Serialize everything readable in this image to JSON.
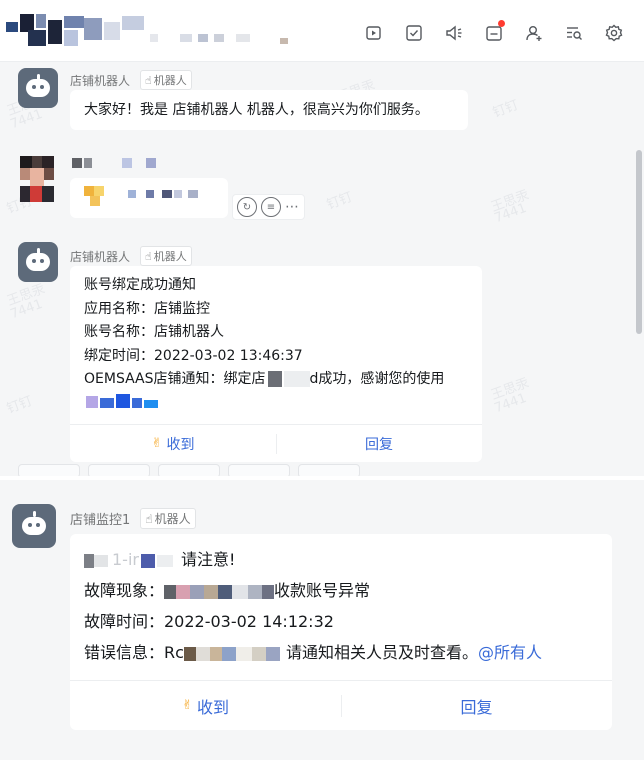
{
  "header": {
    "icons": [
      "video-icon",
      "todo-icon",
      "announcement-icon",
      "calendar-icon",
      "add-member-icon",
      "search-history-icon",
      "settings-icon"
    ],
    "accent": "#3a6bd8",
    "notify_color": "#ff3b30"
  },
  "watermark": {
    "name": "王思汞",
    "id": "7441",
    "app": "钉钉"
  },
  "messages": {
    "greeting": {
      "sender": "店铺机器人",
      "tag": "机器人",
      "text": "大家好！我是 店铺机器人 机器人，很高兴为你们服务。"
    },
    "bind_notice": {
      "sender": "店铺机器人",
      "tag": "机器人",
      "lines": {
        "title": "账号绑定成功通知",
        "app_name": "应用名称：店铺监控",
        "account_name": "账号名称：店铺机器人",
        "bind_time": "绑定时间：2022-03-02 13:46:37",
        "notice_prefix": "OEMSAAS店铺通知：绑定店",
        "notice_suffix": "d成功，感谢您的使用"
      },
      "actions": {
        "received": "收到",
        "reply": "回复"
      }
    },
    "alert": {
      "sender": "店铺监控1",
      "tag": "机器人",
      "lines": {
        "attention_prefix": "1-ir",
        "attention": "请注意!",
        "fault_label": "故障现象：",
        "fault_suffix": "收款账号异常",
        "fault_time": "故障时间：2022-03-02 14:12:32",
        "error_label": "错误信息：",
        "error_code": "Rc",
        "error_suffix": "请通知相关人员及时查看。",
        "mention": "@所有人"
      },
      "actions": {
        "received": "收到",
        "reply": "回复"
      }
    }
  }
}
